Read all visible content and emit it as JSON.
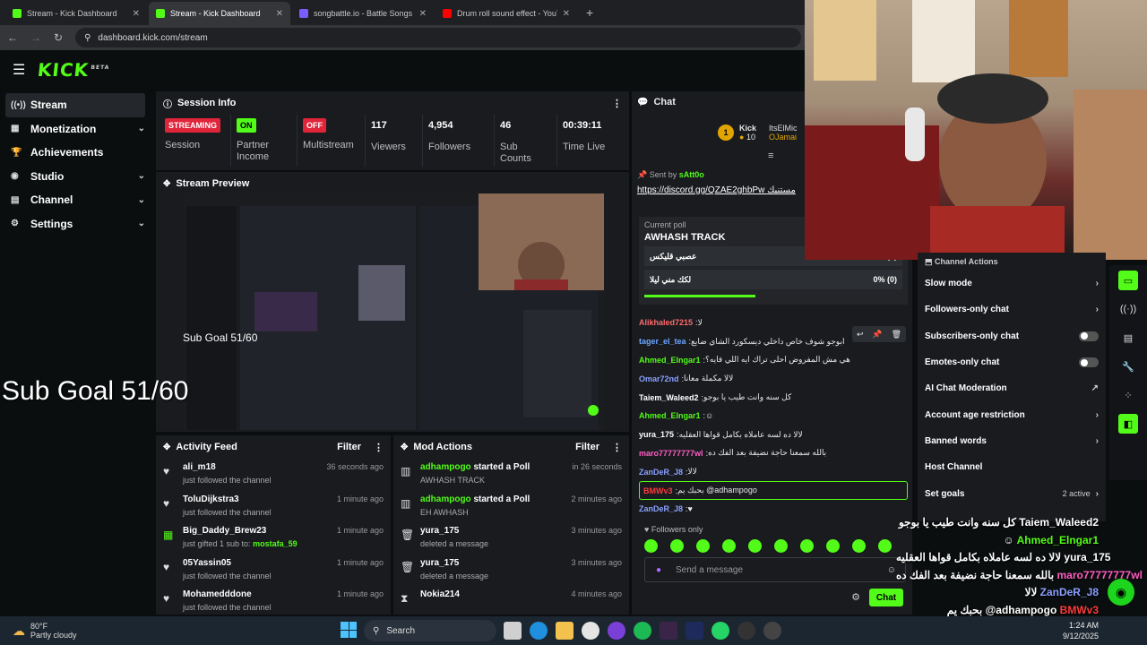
{
  "browser": {
    "tabs": [
      {
        "title": "Stream - Kick Dashboard",
        "active": false,
        "fav": "#53fc18"
      },
      {
        "title": "Stream - Kick Dashboard",
        "active": true,
        "fav": "#53fc18"
      },
      {
        "title": "songbattle.io - Battle Songs ag",
        "active": false,
        "fav": "#7a5cff"
      },
      {
        "title": "Drum roll sound effect - YouTu",
        "active": false,
        "fav": "#ff0000"
      }
    ],
    "url": "dashboard.kick.com/stream"
  },
  "header": {
    "logo": "KICK",
    "logo_sup": "BETA"
  },
  "nav": {
    "items": [
      {
        "label": "Stream",
        "icon": "radio-icon",
        "glyph": "((•))",
        "active": true,
        "chevron": false
      },
      {
        "label": "Monetization",
        "icon": "money-icon",
        "glyph": "▦",
        "active": false,
        "chevron": true
      },
      {
        "label": "Achievements",
        "icon": "trophy-icon",
        "glyph": "🏆",
        "active": false,
        "chevron": false
      },
      {
        "label": "Studio",
        "icon": "studio-icon",
        "glyph": "◉",
        "active": false,
        "chevron": true
      },
      {
        "label": "Channel",
        "icon": "channel-icon",
        "glyph": "▤",
        "active": false,
        "chevron": true
      },
      {
        "label": "Settings",
        "icon": "gear-icon",
        "glyph": "⚙",
        "active": false,
        "chevron": true
      }
    ]
  },
  "session": {
    "title": "Session Info",
    "stats": [
      {
        "badge": "STREAMING",
        "badge_color": "#e0243a",
        "label": "Session",
        "num": "",
        "w": 80
      },
      {
        "badge": "ON",
        "badge_color": "#53fc18",
        "label": "Partner Income",
        "num": "",
        "w": 74
      },
      {
        "badge": "OFF",
        "badge_color": "#e0243a",
        "label": "Multistream",
        "num": "",
        "w": 76
      },
      {
        "badge": "",
        "badge_color": "",
        "label": "Viewers",
        "num": "117",
        "w": 64
      },
      {
        "badge": "",
        "badge_color": "",
        "label": "Followers",
        "num": "4,954",
        "w": 80
      },
      {
        "badge": "",
        "badge_color": "",
        "label": "Sub Counts",
        "num": "46",
        "w": 70
      },
      {
        "badge": "",
        "badge_color": "",
        "label": "Time Live",
        "num": "00:39:11",
        "w": 70
      }
    ]
  },
  "preview": {
    "title": "Stream Preview",
    "sub_goal": "Sub Goal 51/60"
  },
  "overlay": {
    "sub_goal": "Sub Goal 51/60"
  },
  "activity": {
    "title": "Activity Feed",
    "filter": "Filter",
    "items": [
      {
        "icon": "heart-icon",
        "glyph": "♥",
        "name": "ali_m18",
        "sub": "just followed the channel",
        "sub2": "",
        "time": "36 seconds ago"
      },
      {
        "icon": "heart-icon",
        "glyph": "♥",
        "name": "ToluDijkstra3",
        "sub": "just followed the channel",
        "sub2": "",
        "time": "1 minute ago"
      },
      {
        "icon": "gift-icon",
        "glyph": "▦",
        "name": "Big_Daddy_Brew23",
        "sub": "just gifted 1 sub to:",
        "sub2": "mostafa_59",
        "time": "1 minute ago"
      },
      {
        "icon": "heart-icon",
        "glyph": "♥",
        "name": "05Yassin05",
        "sub": "just followed the channel",
        "sub2": "",
        "time": "1 minute ago"
      },
      {
        "icon": "heart-icon",
        "glyph": "♥",
        "name": "Mohamedddone",
        "sub": "just followed the channel",
        "sub2": "",
        "time": "1 minute ago"
      }
    ]
  },
  "mod": {
    "title": "Mod Actions",
    "filter": "Filter",
    "items": [
      {
        "icon": "poll-icon",
        "glyph": "▥",
        "name": "adhampogo",
        "action": "started a Poll",
        "sub": "AWHASH TRACK",
        "time": "in 26 seconds"
      },
      {
        "icon": "poll-icon",
        "glyph": "▥",
        "name": "adhampogo",
        "action": "started a Poll",
        "sub": "EH AWHASH",
        "time": "2 minutes ago"
      },
      {
        "icon": "trash-icon",
        "glyph": "🗑",
        "name": "yura_175",
        "action": "",
        "sub": "deleted a message",
        "time": "3 minutes ago"
      },
      {
        "icon": "trash-icon",
        "glyph": "🗑",
        "name": "yura_175",
        "action": "",
        "sub": "deleted a message",
        "time": "3 minutes ago"
      },
      {
        "icon": "hourglass-icon",
        "glyph": "⧗",
        "name": "Nokia214",
        "action": "",
        "sub": "",
        "time": "4 minutes ago"
      }
    ]
  },
  "chat": {
    "title": "Chat",
    "leader": {
      "rank": "1",
      "name": "Kick",
      "count": "10",
      "name2": "ItsElMic",
      "name3": "OJamai"
    },
    "pinned_by": "Sent by",
    "pinned_user": "sAtt0o",
    "pinned_text": "https://discord.gg/QZAE2ghbPw مستنيك",
    "poll_label": "Current poll",
    "poll_title": "AWHASH TRACK",
    "poll_options": [
      {
        "label": "عصبي قليكس",
        "pct": "0% (0)"
      },
      {
        "label": "لكك مني ليلا",
        "pct": "0% (0)"
      }
    ],
    "messages": [
      {
        "user": "Alikhaled7215",
        "color": "#ff6b6b",
        "text": "لا"
      },
      {
        "user": "tager_el_tea",
        "color": "#6ba6ff",
        "text": "ابوجو شوف خاص داخلي ديسكورد الشاي ضايع"
      },
      {
        "user": "Ahmed_Elngar1",
        "color": "#53fc18",
        "text": "هي مش المفروض احلى تراك ايه اللي فايه؟"
      },
      {
        "user": "Omar72nd",
        "color": "#8aa0ff",
        "text": "لالا مكملة معانا"
      },
      {
        "user": "Taiem_Waleed2",
        "color": "#ffffff",
        "text": "كل سنه وانت طيب يا بوجو"
      },
      {
        "user": "Ahmed_Elngar1",
        "color": "#53fc18",
        "text": "☺"
      },
      {
        "user": "yura_175",
        "color": "#ffffff",
        "text": "لالا ده لسه عاملاه بكامل قواها العقليه"
      },
      {
        "user": "maro77777777wl",
        "color": "#ff5ec4",
        "text": "بالله سمعنا حاجة نضيفة بعد الفك ده"
      },
      {
        "user": "ZanDeR_J8",
        "color": "#8aa0ff",
        "text": "لالا"
      },
      {
        "user": "BMWv3",
        "color": "#ff3b3b",
        "text": "بحبك يم @adhampogo"
      },
      {
        "user": "ZanDeR_J8",
        "color": "#8aa0ff",
        "text": "♥"
      }
    ],
    "followers_only": "Followers only",
    "placeholder": "Send a message",
    "send": "Chat"
  },
  "actions": {
    "title": "Channel Actions",
    "items": [
      {
        "label": "Slow mode",
        "kind": "chev",
        "extra": ""
      },
      {
        "label": "Followers-only chat",
        "kind": "chev",
        "extra": ""
      },
      {
        "label": "Subscribers-only chat",
        "kind": "toggle",
        "extra": ""
      },
      {
        "label": "Emotes-only chat",
        "kind": "toggle",
        "extra": ""
      },
      {
        "label": "AI Chat Moderation",
        "kind": "link",
        "extra": ""
      },
      {
        "label": "Account age restriction",
        "kind": "chev",
        "extra": ""
      },
      {
        "label": "Banned words",
        "kind": "chev",
        "extra": ""
      },
      {
        "label": "Host Channel",
        "kind": "none",
        "extra": ""
      },
      {
        "label": "Set goals",
        "kind": "chev",
        "extra": "2 active"
      }
    ]
  },
  "overlay_chat": [
    {
      "user": "Taiem_Waleed2",
      "color": "#ffffff",
      "text": "كل سنه وانت طيب يا بوجو"
    },
    {
      "user": "Ahmed_Elngar1",
      "color": "#53fc18",
      "text": "☺"
    },
    {
      "user": "yura_175",
      "color": "#ffffff",
      "text": "لالا ده لسه عاملاه بكامل قواها العقليه"
    },
    {
      "user": "maro77777777wl",
      "color": "#ff5ec4",
      "text": "بالله سمعنا حاجة نضيفة بعد الفك ده"
    },
    {
      "user": "ZanDeR_J8",
      "color": "#8aa0ff",
      "text": "لالا"
    },
    {
      "user": "BMWv3",
      "color": "#ff3b3b",
      "text": "بحبك يم @adhampogo"
    },
    {
      "user": "ZanDeR_J8",
      "color": "#8aa0ff",
      "text": "♥"
    }
  ],
  "taskbar": {
    "temp": "80°F",
    "weather": "Partly cloudy",
    "search": "Search",
    "time": "1:24 AM",
    "date": "9/12/2025"
  },
  "colors": {
    "accent": "#53fc18",
    "panel": "#191b1f",
    "bg": "#0b0e0f"
  }
}
